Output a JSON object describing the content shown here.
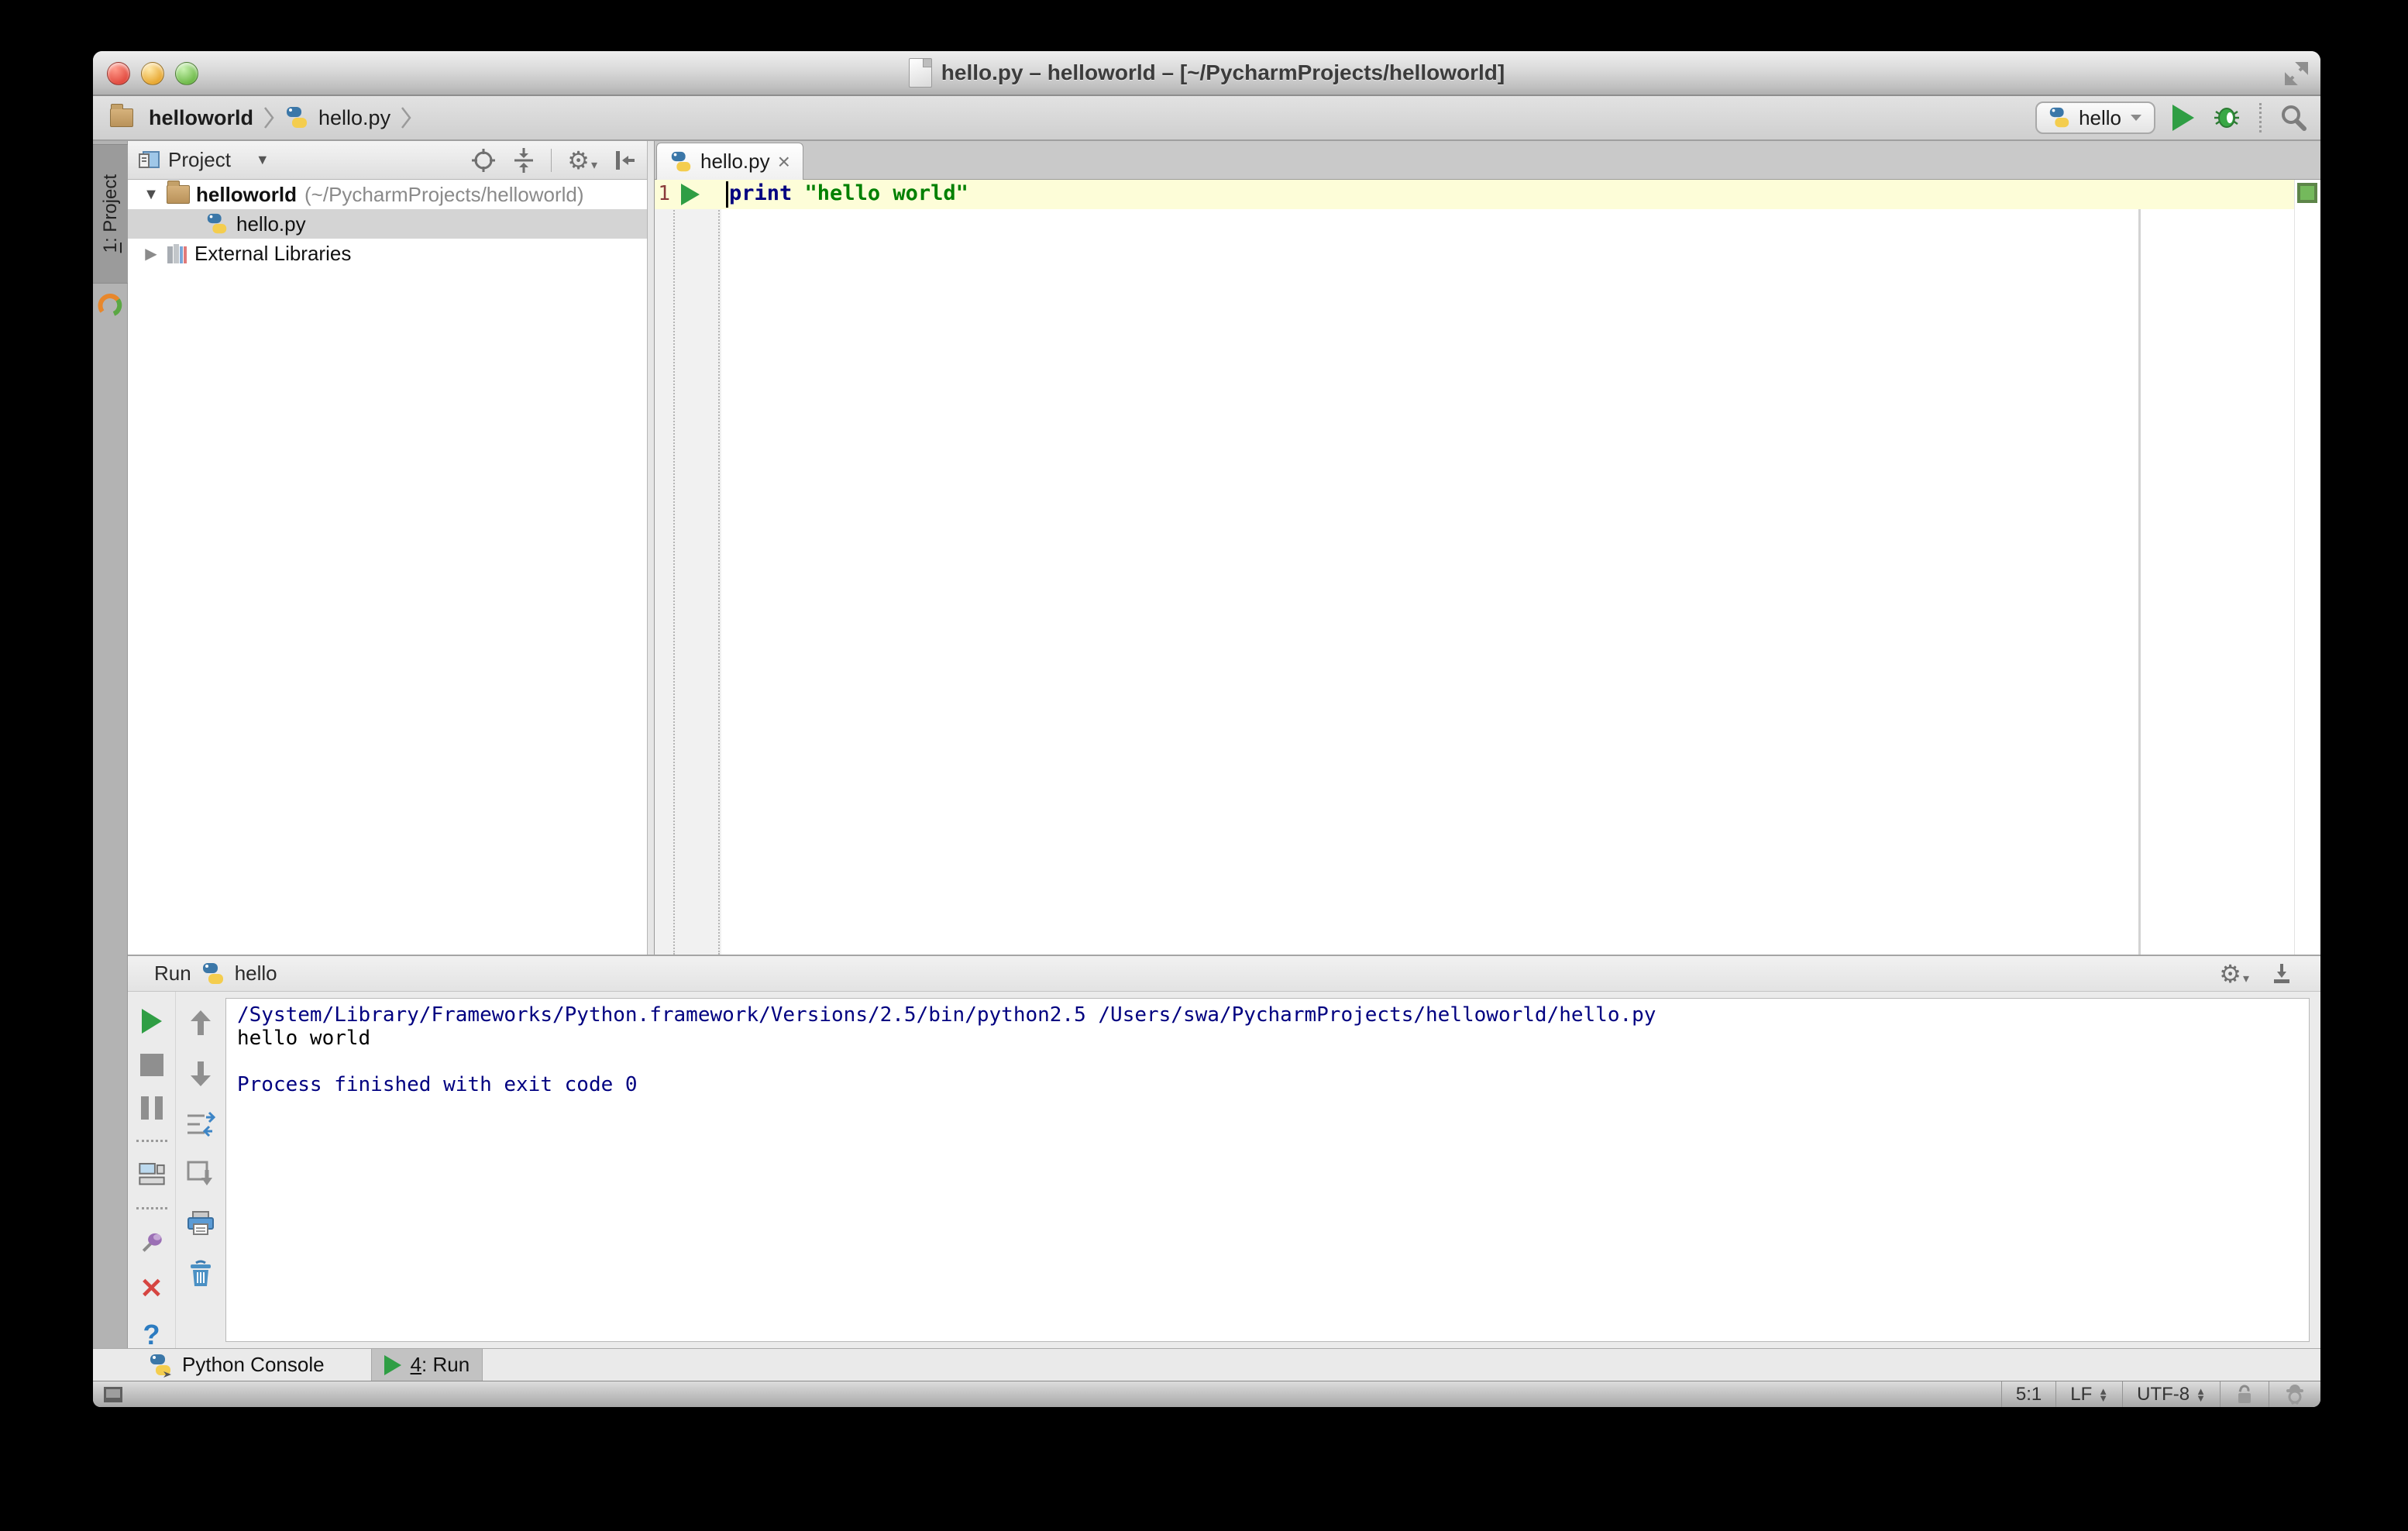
{
  "window": {
    "title": "hello.py – helloworld – [~/PycharmProjects/helloworld]"
  },
  "nav": {
    "breadcrumb_project": "helloworld",
    "breadcrumb_file": "hello.py",
    "run_config": "hello"
  },
  "tool_strips": {
    "project_button": {
      "number": "1",
      "label": ": Project"
    }
  },
  "project_panel": {
    "header": "Project",
    "root_name": "helloworld",
    "root_path": "(~/PycharmProjects/helloworld)",
    "file": "hello.py",
    "external_libraries": "External Libraries"
  },
  "editor": {
    "tab": "hello.py",
    "line_number": "1",
    "keyword": "print",
    "string": "\"hello world\""
  },
  "run_panel": {
    "label": "Run",
    "config": "hello",
    "console_lines": [
      {
        "text": "/System/Library/Frameworks/Python.framework/Versions/2.5/bin/python2.5 /Users/swa/PycharmProjects/helloworld/hello.py",
        "style": "info"
      },
      {
        "text": "hello world",
        "style": "stdout"
      },
      {
        "text": "",
        "style": "blank"
      },
      {
        "text": "Process finished with exit code 0",
        "style": "info"
      }
    ]
  },
  "bottom_bar": {
    "python_console": "Python Console",
    "run_tab": {
      "number": "4",
      "label": ": Run"
    }
  },
  "status_bar": {
    "caret": "5:1",
    "line_separator": "LF",
    "encoding": "UTF-8"
  },
  "colors": {
    "run_green": "#2f9e44",
    "selection_gray": "#d4d4d4",
    "current_line_yellow": "#fdfdd8",
    "keyword_blue": "#000080",
    "string_green": "#008000",
    "console_info_blue": "#000080",
    "inspection_ok_green": "#74b95c",
    "folder_tan": "#c3a068"
  },
  "icons": {
    "title_bar": [
      "close-traffic-icon",
      "minimize-traffic-icon",
      "zoom-traffic-icon",
      "document-icon",
      "expand-icon"
    ],
    "nav": [
      "folder-icon",
      "chevron-icon",
      "python-file-icon",
      "run-config-python-icon",
      "dropdown-arrow-icon",
      "run-icon",
      "debug-icon",
      "search-icon"
    ],
    "project_header": [
      "project-view-icon",
      "dropdown-arrow-icon",
      "locate-icon",
      "collapse-all-icon",
      "settings-gear-icon",
      "hide-panel-icon"
    ],
    "project_tree": [
      "expanded-arrow-icon",
      "folder-icon",
      "python-file-icon",
      "collapsed-arrow-icon",
      "libraries-icon"
    ],
    "editor": [
      "run-gutter-icon",
      "close-tab-icon",
      "inspection-ok-marker"
    ],
    "run_toolbar": [
      "rerun-icon",
      "stop-icon",
      "pause-output-icon",
      "restore-layout-icon",
      "pin-icon",
      "close-icon",
      "help-icon",
      "up-stack-icon",
      "down-stack-icon",
      "soft-wrap-icon",
      "scroll-end-icon",
      "print-icon",
      "clear-all-icon"
    ],
    "run_header": [
      "settings-gear-icon",
      "hide-down-icon"
    ],
    "bottom_bar": [
      "python-console-icon",
      "run-tab-icon"
    ],
    "status_bar": [
      "toggle-toolbars-icon",
      "unlock-icon",
      "inspector-icon"
    ]
  }
}
